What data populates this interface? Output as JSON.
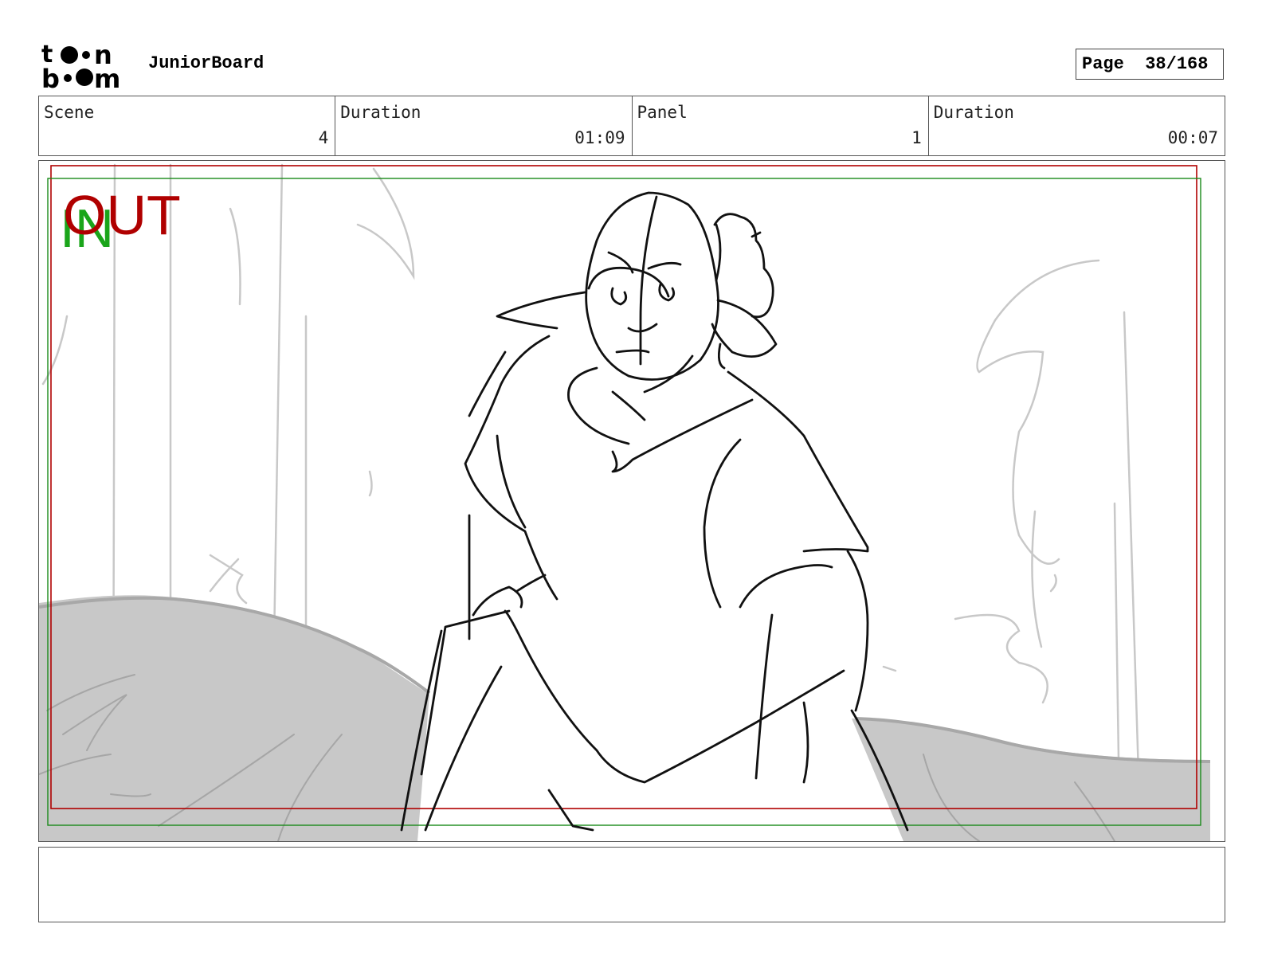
{
  "header": {
    "logo_text_top": "toon",
    "logo_text_bottom": "boom",
    "app_name": "JuniorBoard",
    "page_label": "Page",
    "page_number": "38/168"
  },
  "info": {
    "scene_label": "Scene",
    "scene_value": "4",
    "scene_duration_label": "Duration",
    "scene_duration_value": "01:09",
    "panel_label": "Panel",
    "panel_value": "1",
    "panel_duration_label": "Duration",
    "panel_duration_value": "00:07"
  },
  "panel_image": {
    "in_marker": "IN",
    "out_marker": "OUT",
    "in_color": "#1aa51a",
    "out_color": "#b00000"
  },
  "notes": {
    "text": ""
  }
}
